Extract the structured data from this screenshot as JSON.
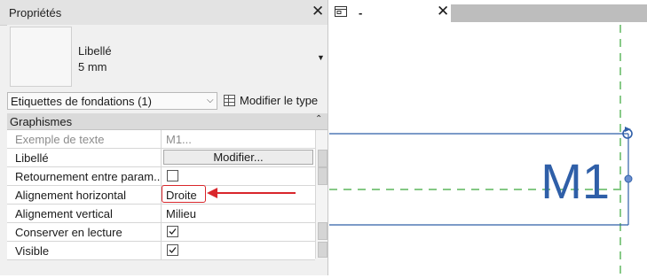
{
  "panel": {
    "title": "Propriétés",
    "type_name": "Libellé",
    "type_size": "5 mm",
    "selector_value": "Etiquettes de fondations (1)",
    "modify_type_label": "Modifier le type",
    "section": "Graphismes"
  },
  "rows": [
    {
      "name": "Exemple de texte",
      "value": "M1..."
    },
    {
      "name": "Libellé",
      "button": "Modifier..."
    },
    {
      "name": "Retournement entre param..."
    },
    {
      "name": "Alignement horizontal",
      "value": "Droite"
    },
    {
      "name": "Alignement vertical",
      "value": "Milieu"
    },
    {
      "name": "Conserver en lecture"
    },
    {
      "name": "Visible"
    }
  ],
  "checkboxes": {
    "retournement": false,
    "conserver_en_lecture": true,
    "visible": true
  },
  "view": {
    "tab_title": "-",
    "tag_text": "M1"
  },
  "colors": {
    "highlight": "#d9262b",
    "tag_blue": "#2f5fa8",
    "gridline_green": "#3aa63a"
  },
  "icons": [
    "close-icon",
    "dropdown-arrow-icon",
    "chevron-down-icon",
    "edit-type-icon",
    "collapse-icon",
    "view-icon",
    "checkmark-icon",
    "rotate-handle-icon"
  ]
}
